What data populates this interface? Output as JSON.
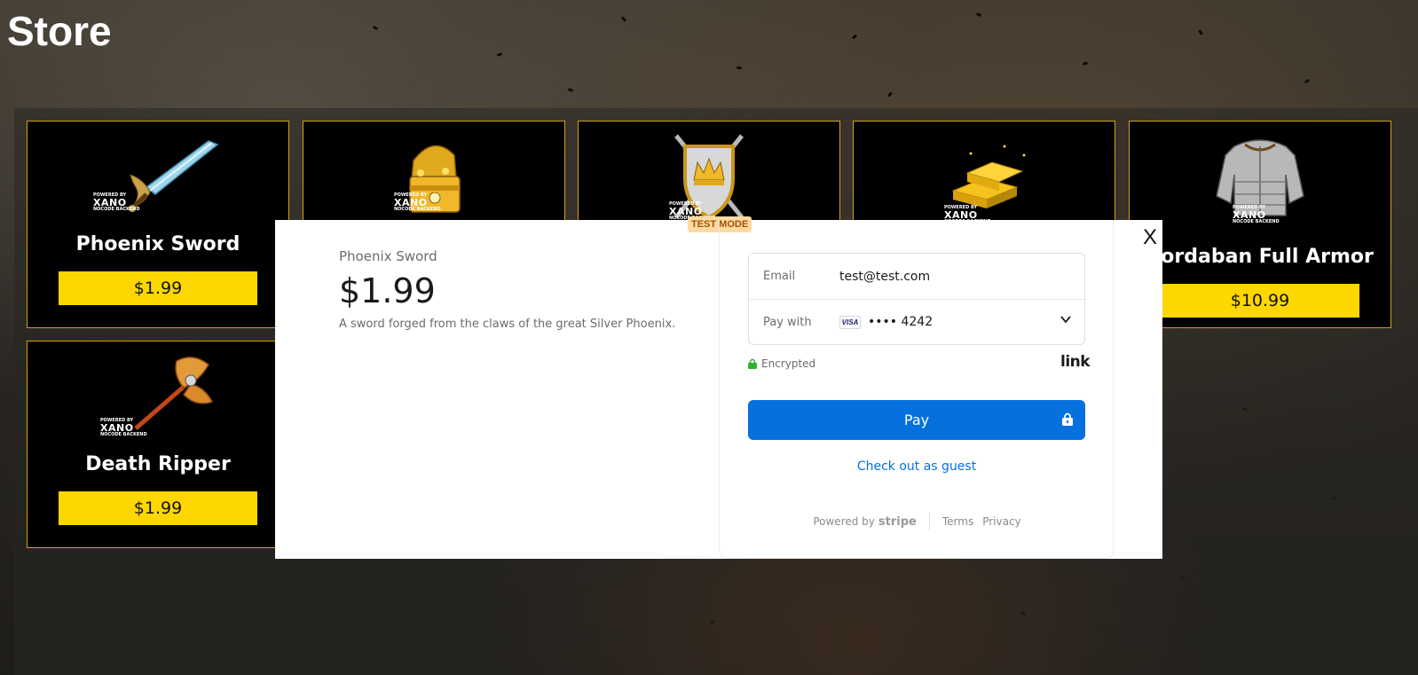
{
  "page": {
    "title": "Store"
  },
  "products": [
    {
      "name": "Phoenix Sword",
      "price": "$1.99",
      "icon": "sword-icon"
    },
    {
      "name": "",
      "price": "",
      "icon": "treasure-chest-icon"
    },
    {
      "name": "",
      "price": "",
      "icon": "crown-shield-icon"
    },
    {
      "name": "",
      "price": "",
      "icon": "gold-bars-icon"
    },
    {
      "name": "Cordaban Full Armor",
      "price": "$10.99",
      "icon": "armor-icon"
    },
    {
      "name": "Death Ripper",
      "price": "$1.99",
      "icon": "axe-icon"
    }
  ],
  "watermark": {
    "line1": "POWERED BY",
    "line2": "XANO",
    "line3": "NOCODE BACKEND"
  },
  "checkout": {
    "test_mode": "TEST MODE",
    "close_label": "X",
    "product_name": "Phoenix Sword",
    "price": "$1.99",
    "description": "A sword forged from the claws of the great Silver Phoenix.",
    "email_label": "Email",
    "email_value": "test@test.com",
    "pay_with_label": "Pay with",
    "card_brand": "VISA",
    "card_masked": "•••• 4242",
    "encrypted_label": "Encrypted",
    "link_logo": "link",
    "pay_button": "Pay",
    "guest_link": "Check out as guest",
    "powered_by": "Powered by",
    "stripe": "stripe",
    "terms": "Terms",
    "privacy": "Privacy",
    "colors": {
      "accent": "#0570de",
      "price_button": "#ffd700",
      "card_border": "#d4a017"
    }
  }
}
